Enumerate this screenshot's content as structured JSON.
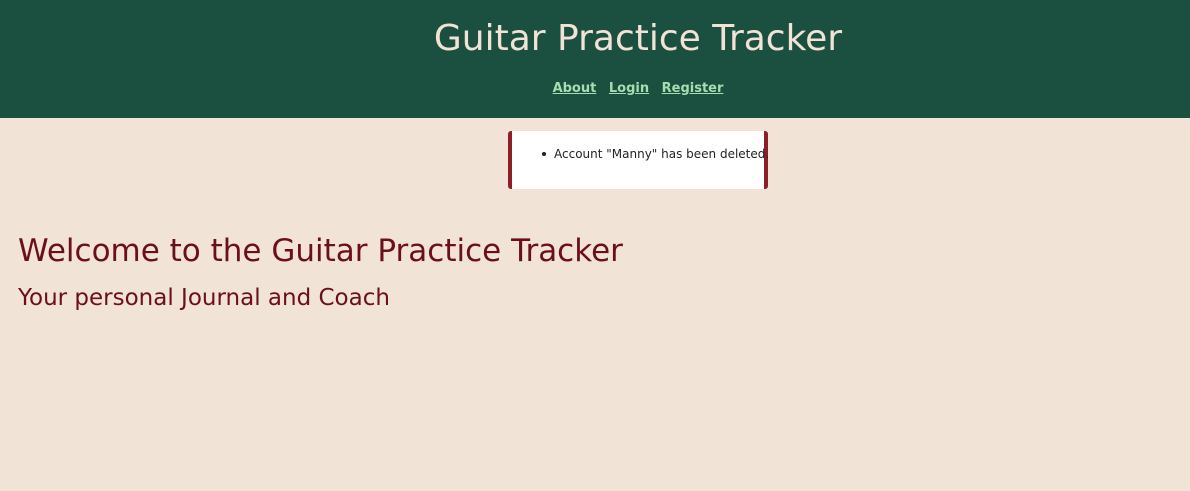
{
  "header": {
    "title": "Guitar Practice Tracker",
    "nav": {
      "about": "About",
      "login": "Login",
      "register": "Register"
    }
  },
  "flash": {
    "messages": [
      "Account \"Manny\" has been deleted."
    ]
  },
  "main": {
    "heading": "Welcome to the Guitar Practice Tracker",
    "subheading": "Your personal Journal and Coach"
  },
  "colors": {
    "header_bg": "#1b4f40",
    "page_bg": "#f1e3d6",
    "nav_link": "#a7ddb0",
    "heading": "#6b0f1a",
    "flash_border": "#8a1f28"
  }
}
